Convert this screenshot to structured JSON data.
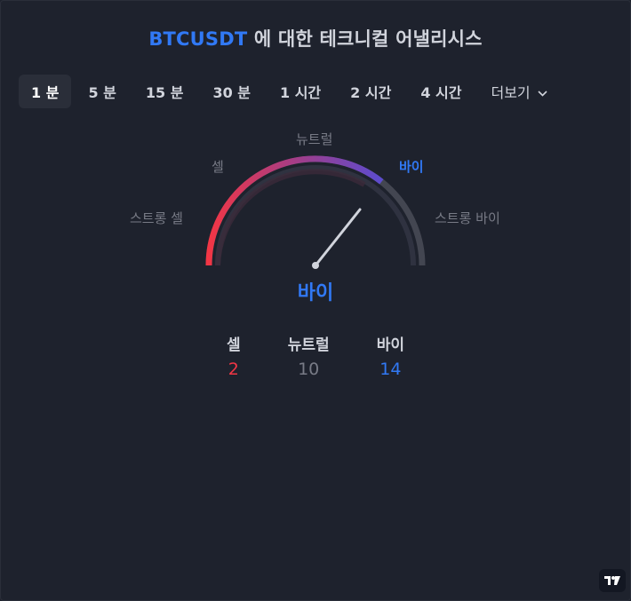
{
  "header": {
    "symbol": "BTCUSDT",
    "title_rest": " 에 대한 테크니컬 어낼리시스"
  },
  "tabs": [
    {
      "label": "1 분",
      "active": true
    },
    {
      "label": "5 분"
    },
    {
      "label": "15 분"
    },
    {
      "label": "30 분"
    },
    {
      "label": "1 시간"
    },
    {
      "label": "2 시간"
    },
    {
      "label": "4 시간"
    },
    {
      "label": "더보기",
      "more": true
    }
  ],
  "gauge": {
    "labels": {
      "strong_sell": "스트롱 셀",
      "sell": "셀",
      "neutral": "뉴트럴",
      "buy": "바이",
      "strong_buy": "스트롱 바이"
    },
    "active_label": "buy",
    "verdict": "바이",
    "colors": {
      "sell": "#f23645",
      "buy": "#3179f5",
      "track": "#434651"
    }
  },
  "counts": {
    "sell": {
      "label": "셀",
      "value": "2"
    },
    "neutral": {
      "label": "뉴트럴",
      "value": "10"
    },
    "buy": {
      "label": "바이",
      "value": "14"
    }
  },
  "icons": {
    "logo": "tradingview-logo-icon",
    "more": "chevron-down-icon"
  }
}
